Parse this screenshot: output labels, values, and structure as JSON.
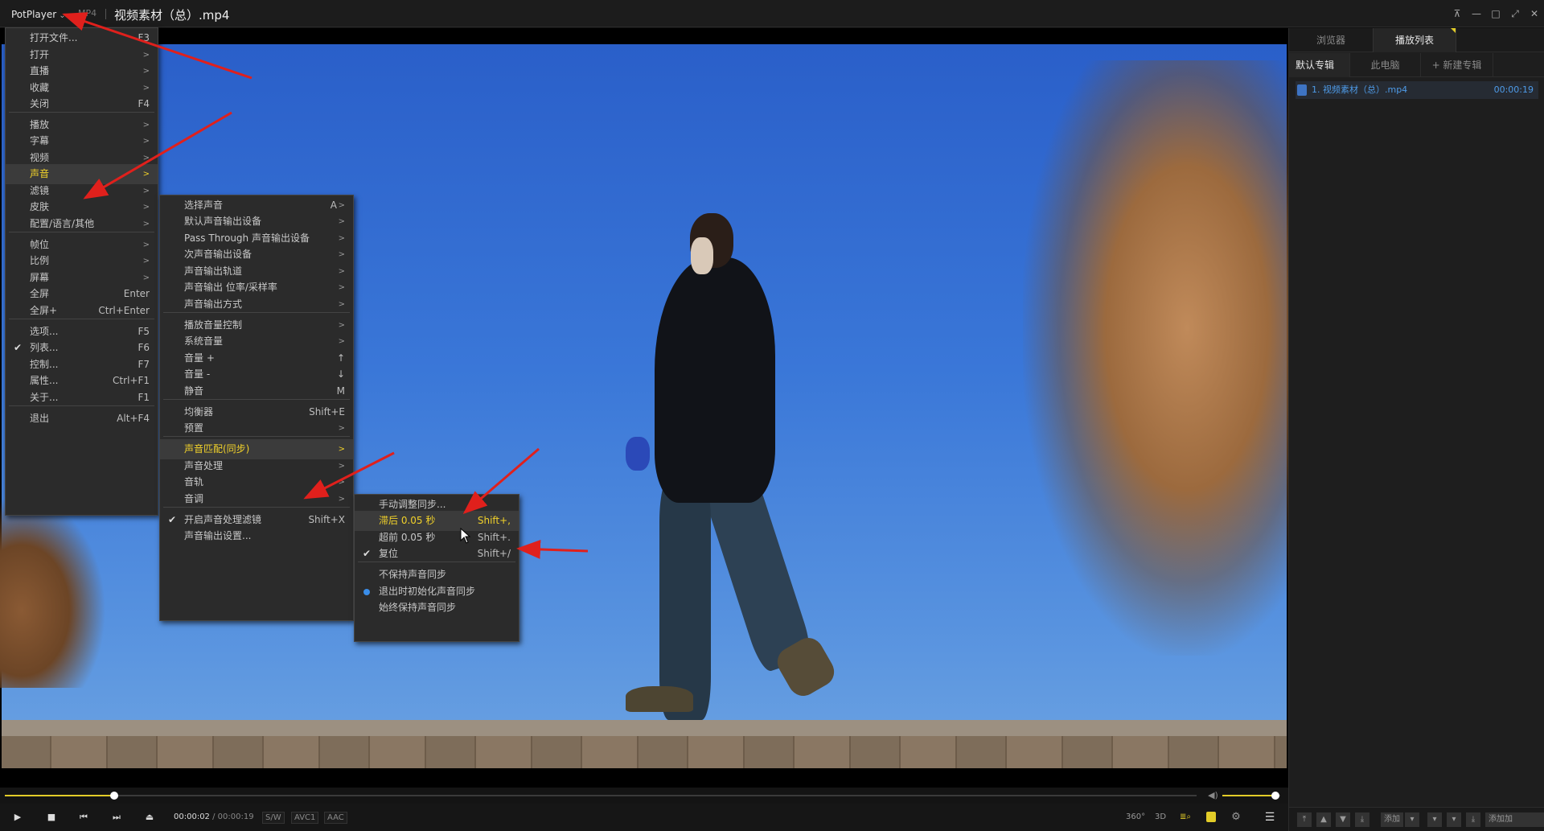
{
  "titlebar": {
    "app_menu": "PotPlayer",
    "format": "MP4",
    "file_title": "视频素材（总）.mp4",
    "buttons": [
      "pin-icon",
      "minimize-icon",
      "maximize-icon",
      "fullscreen-icon",
      "close-icon"
    ]
  },
  "main_menu": {
    "items": [
      {
        "label": "打开文件...",
        "shortcut": "F3"
      },
      {
        "label": "打开",
        "arrow": ">"
      },
      {
        "label": "直播",
        "arrow": ">"
      },
      {
        "label": "收藏",
        "arrow": ">"
      },
      {
        "label": "关闭",
        "shortcut": "F4"
      },
      {
        "label": "播放",
        "arrow": ">"
      },
      {
        "label": "字幕",
        "arrow": ">"
      },
      {
        "label": "视频",
        "arrow": ">"
      },
      {
        "label": "声音",
        "arrow": ">"
      },
      {
        "label": "滤镜",
        "arrow": ">"
      },
      {
        "label": "皮肤",
        "arrow": ">"
      },
      {
        "label": "配置/语言/其他",
        "arrow": ">"
      },
      {
        "label": "帧位",
        "arrow": ">"
      },
      {
        "label": "比例",
        "arrow": ">"
      },
      {
        "label": "屏幕",
        "arrow": ">"
      },
      {
        "label": "全屏",
        "shortcut": "Enter"
      },
      {
        "label": "全屏+",
        "shortcut": "Ctrl+Enter"
      },
      {
        "label": "选项...",
        "shortcut": "F5"
      },
      {
        "label": "列表...",
        "shortcut": "F6"
      },
      {
        "label": "控制...",
        "shortcut": "F7"
      },
      {
        "label": "属性...",
        "shortcut": "Ctrl+F1"
      },
      {
        "label": "关于...",
        "shortcut": "F1"
      },
      {
        "label": "退出",
        "shortcut": "Alt+F4"
      }
    ]
  },
  "sound_menu": {
    "items": [
      {
        "label": "选择声音",
        "shortcut": "A",
        "arrow": ">"
      },
      {
        "label": "默认声音输出设备",
        "arrow": ">"
      },
      {
        "label": "Pass Through 声音输出设备",
        "arrow": ">"
      },
      {
        "label": "次声音输出设备",
        "arrow": ">"
      },
      {
        "label": "声音输出轨道",
        "arrow": ">"
      },
      {
        "label": "声音输出 位率/采样率",
        "arrow": ">"
      },
      {
        "label": "声音输出方式",
        "arrow": ">"
      },
      {
        "label": "播放音量控制",
        "arrow": ">"
      },
      {
        "label": "系统音量",
        "arrow": ">"
      },
      {
        "label": "音量 +",
        "shortcut": "↑"
      },
      {
        "label": "音量 -",
        "shortcut": "↓"
      },
      {
        "label": "静音",
        "shortcut": "M"
      },
      {
        "label": "均衡器",
        "shortcut": "Shift+E"
      },
      {
        "label": "预置",
        "arrow": ">"
      },
      {
        "label": "声音匹配(同步)",
        "arrow": ">"
      },
      {
        "label": "声音处理",
        "arrow": ">"
      },
      {
        "label": "音轨",
        "arrow": ">"
      },
      {
        "label": "音调",
        "arrow": ">"
      },
      {
        "label": "开启声音处理滤镜",
        "shortcut": "Shift+X"
      },
      {
        "label": "声音输出设置..."
      }
    ]
  },
  "sync_menu": {
    "items": [
      {
        "label": "手动调整同步..."
      },
      {
        "label": "滞后 0.05 秒",
        "shortcut": "Shift+,"
      },
      {
        "label": "超前 0.05 秒",
        "shortcut": "Shift+."
      },
      {
        "label": "复位",
        "shortcut": "Shift+/"
      },
      {
        "label": "不保持声音同步"
      },
      {
        "label": "退出时初始化声音同步"
      },
      {
        "label": "始终保持声音同步"
      }
    ]
  },
  "controls": {
    "time_current": "00:00:02",
    "time_sep": "/",
    "time_total": "00:00:19",
    "tags": [
      "S/W",
      "AVC1",
      "AAC"
    ],
    "progress": 0.092,
    "volume": 0.92,
    "labels": {
      "btn360": "360°",
      "btn3d": "3D"
    }
  },
  "panel": {
    "tabs": [
      "浏览器",
      "播放列表"
    ],
    "subtabs": [
      "默认专辑",
      "此电脑",
      "+ 新建专辑"
    ],
    "playlist": [
      {
        "name": "1. 视频素材（总）.mp4",
        "duration": "00:00:19"
      }
    ],
    "bottom_add": "添加",
    "bottom_add2": "添加加"
  },
  "colors": {
    "accent": "#e2cc28",
    "playlist_text": "#4e9be8",
    "annotation_arrow": "#e0201c"
  }
}
